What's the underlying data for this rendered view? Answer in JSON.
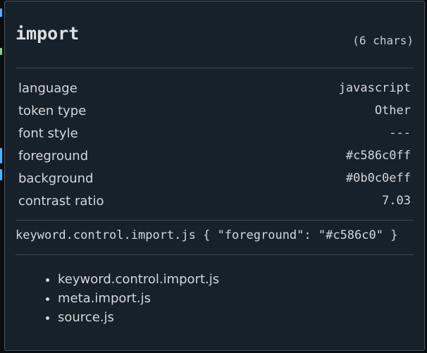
{
  "header": {
    "token": "import",
    "char_count": "(6 chars)"
  },
  "properties": [
    {
      "label": "language",
      "value": "javascript"
    },
    {
      "label": "token type",
      "value": "Other"
    },
    {
      "label": "font style",
      "value": "---"
    },
    {
      "label": "foreground",
      "value": "#c586c0ff"
    },
    {
      "label": "background",
      "value": "#0b0c0eff"
    },
    {
      "label": "contrast ratio",
      "value": "7.03"
    }
  ],
  "theme_rule": "keyword.control.import.js { \"foreground\": \"#c586c0\" }",
  "scopes": [
    "keyword.control.import.js",
    "meta.import.js",
    "source.js"
  ],
  "colors": {
    "hover_background": "#16212a",
    "hover_border": "#4b5560",
    "editor_background": "#0b0c0e",
    "token_foreground": "#c586c0"
  }
}
